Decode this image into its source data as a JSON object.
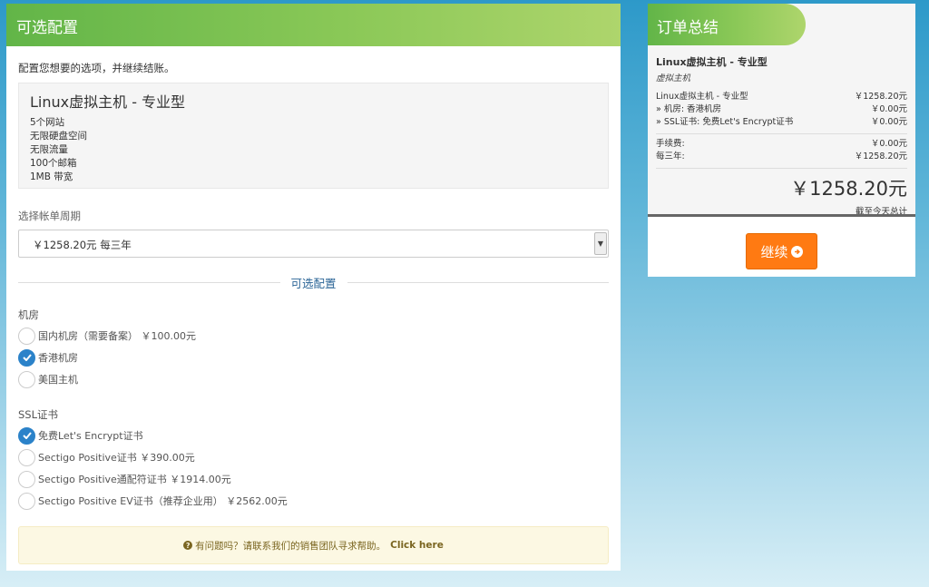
{
  "left": {
    "header_title": "可选配置",
    "intro": "配置您想要的选项，并继续结账。",
    "product": {
      "name": "Linux虚拟主机 - 专业型",
      "features": [
        "5个网站",
        "无限硬盘空间",
        "无限流量",
        "100个邮箱",
        "1MB 带宽"
      ]
    },
    "billing_cycle": {
      "label": "选择帐单周期",
      "selected": "￥1258.20元 每三年"
    },
    "divider_title": "可选配置",
    "groups": [
      {
        "label": "机房",
        "options": [
          {
            "text": "国内机房（需要备案） ￥100.00元",
            "checked": false
          },
          {
            "text": "香港机房",
            "checked": true
          },
          {
            "text": "美国主机",
            "checked": false
          }
        ]
      },
      {
        "label": "SSL证书",
        "options": [
          {
            "text": "免费Let's Encrypt证书",
            "checked": true
          },
          {
            "text": "Sectigo Positive证书 ￥390.00元",
            "checked": false
          },
          {
            "text": "Sectigo Positive通配符证书 ￥1914.00元",
            "checked": false
          },
          {
            "text": "Sectigo Positive EV证书（推荐企业用） ￥2562.00元",
            "checked": false
          }
        ]
      }
    ],
    "help": {
      "icon": "question-icon",
      "text": "有问题吗？请联系我们的销售团队寻求帮助。",
      "link": "Click here"
    }
  },
  "summary": {
    "header_title": "订单总结",
    "product_name": "Linux虚拟主机 - 专业型",
    "product_group": "虚拟主机",
    "lines": [
      {
        "label": "Linux虚拟主机 - 专业型",
        "value": "￥1258.20元"
      },
      {
        "label": "» 机房: 香港机房",
        "value": "￥0.00元"
      },
      {
        "label": "» SSL证书: 免费Let's Encrypt证书",
        "value": "￥0.00元"
      }
    ],
    "fees": [
      {
        "label": "手续费:",
        "value": "￥0.00元"
      },
      {
        "label": "每三年:",
        "value": "￥1258.20元"
      }
    ],
    "total": "￥1258.20元",
    "total_note": "截至今天总计",
    "continue_label": "继续"
  },
  "colors": {
    "header_green": "#62b548",
    "accent_blue": "#2b82c9",
    "button_orange": "#ff7a12"
  }
}
